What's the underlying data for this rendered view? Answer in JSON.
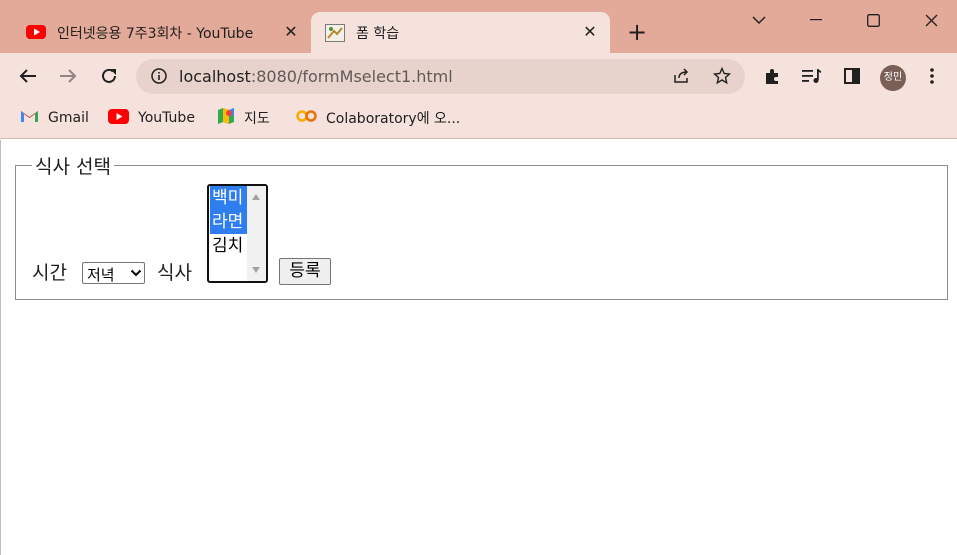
{
  "tabs": [
    {
      "title": "인터넷응용 7주3회차 - YouTube",
      "favicon": "youtube-icon",
      "active": false
    },
    {
      "title": "폼 학습",
      "favicon": "page-favicon-icon",
      "active": true
    }
  ],
  "address_bar": {
    "host": "localhost",
    "path": ":8080/formMselect1.html"
  },
  "profile": {
    "initials": "정민"
  },
  "bookmarks": [
    {
      "label": "Gmail",
      "icon": "gmail-icon"
    },
    {
      "label": "YouTube",
      "icon": "youtube-icon"
    },
    {
      "label": "지도",
      "icon": "maps-icon"
    },
    {
      "label": "Colaboratory에 오...",
      "icon": "colab-icon"
    }
  ],
  "form": {
    "legend": "식사 선택",
    "time_label": "시간",
    "time_select": {
      "value": "저녁"
    },
    "meal_label": "식사",
    "meal_options": [
      {
        "label": "백미",
        "selected": true
      },
      {
        "label": "라면",
        "selected": true
      },
      {
        "label": "김치",
        "selected": false
      }
    ],
    "submit_label": "등록"
  },
  "colors": {
    "tabstrip": "#e3a999",
    "active_tab": "#f6e2dd",
    "selection": "#2f7ef0"
  }
}
